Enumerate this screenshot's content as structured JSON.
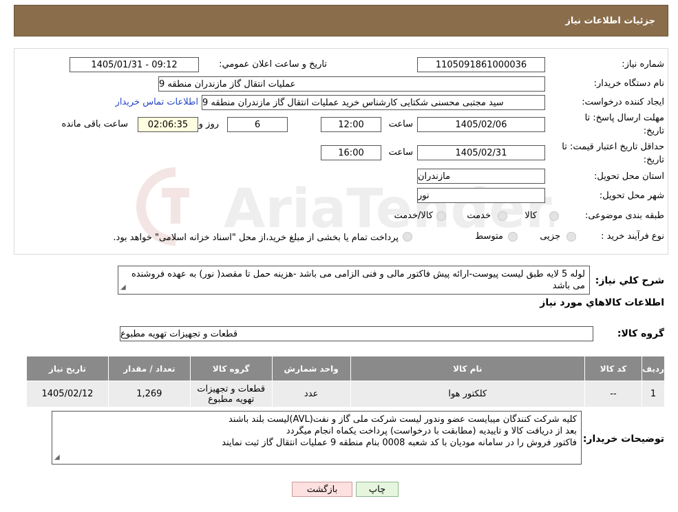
{
  "header": {
    "title": "جزئیات اطلاعات نیاز"
  },
  "form": {
    "need_number_label": "شماره نیاز:",
    "need_number": "1105091861000036",
    "announce_label": "تاریخ و ساعت اعلان عمومي:",
    "announce_value": "1405/01/31 - 09:12",
    "buyer_org_label": "نام دستگاه خریدار:",
    "buyer_org": "عملیات انتقال گاز مازندران منطقه 9",
    "creator_label": "ایجاد کننده درخواست:",
    "creator": "سید مجتبی محسنی شکتایی کارشناس خرید عملیات انتقال گاز مازندران منطقه 9",
    "contact_link": "اطلاعات تماس خریدار",
    "deadline_label_1": "مهلت ارسال پاسخ: تا",
    "deadline_label_2": "تاریخ:",
    "deadline_date": "1405/02/06",
    "time_label": "ساعت",
    "deadline_time": "12:00",
    "days_value": "6",
    "days_label": "روز و",
    "remaining_time": "02:06:35",
    "remaining_label": "ساعت باقی مانده",
    "validity_label_1": "حداقل تاریخ اعتبار قیمت: تا",
    "validity_label_2": "تاریخ:",
    "validity_date": "1405/02/31",
    "validity_time": "16:00",
    "province_label": "استان محل تحویل:",
    "province": "مازندران",
    "city_label": "شهر محل تحویل:",
    "city": "نور",
    "category_label": "طبقه بندی موضوعی:",
    "category_options": [
      "کالا",
      "خدمت",
      "کالا/خدمت"
    ],
    "process_label": "نوع فرآیند خرید :",
    "process_options": [
      "جزیی",
      "متوسط"
    ],
    "process_note": "پرداخت تمام یا بخشی از مبلغ خرید،از محل \"اسناد خزانه اسلامی\" خواهد بود."
  },
  "description": {
    "label": "شرح کلي نياز:",
    "text": "لوله 5 لایه طبق لیست پیوست-ارائه پیش فاکتور مالی و فنی الزامی می باشد -هزینه حمل تا مقصد( نور) به عهده فروشنده می باشد"
  },
  "goods": {
    "section_title": "اطلاعات کالاهاي مورد نياز",
    "group_label": "گروه کالا:",
    "group_value": "قطعات و تجهیزات تهویه مطبوع",
    "columns": [
      "ردیف",
      "کد کالا",
      "نام کالا",
      "واحد شمارش",
      "گروه کالا",
      "تعداد / مقدار",
      "تاریخ نیاز"
    ],
    "rows": [
      {
        "row": "1",
        "code": "--",
        "name": "کلکتور هوا",
        "unit": "عدد",
        "group": "قطعات و تجهیزات تهویه مطبوع",
        "qty": "1,269",
        "date": "1405/02/12"
      }
    ]
  },
  "buyer_notes": {
    "label": "توضیحات خریدار:",
    "lines": [
      "کلیه شرکت کنندگان میبایست عضو وندور لیست شرکت ملی گاز و نفت(AVL)لیست بلند باشند",
      "بعد از دریافت کالا و تاییدیه (مطابقت با درخواست) پرداخت یکماه انجام میگردد",
      "فاکتور فروش را در سامانه مودیان با کد شعبه 0008 بنام منطقه 9 عملیات انتقال گاز ثبت نمایند"
    ]
  },
  "buttons": {
    "print": "چاپ",
    "back": "بازگشت"
  },
  "watermark": {
    "text": "AriaTender.neT"
  },
  "colors": {
    "header_bg": "#8a6d4a",
    "table_header_bg": "#8a8a8a",
    "link": "#2545c8",
    "print_btn": "#e6f6de",
    "back_btn": "#fde0e0"
  }
}
